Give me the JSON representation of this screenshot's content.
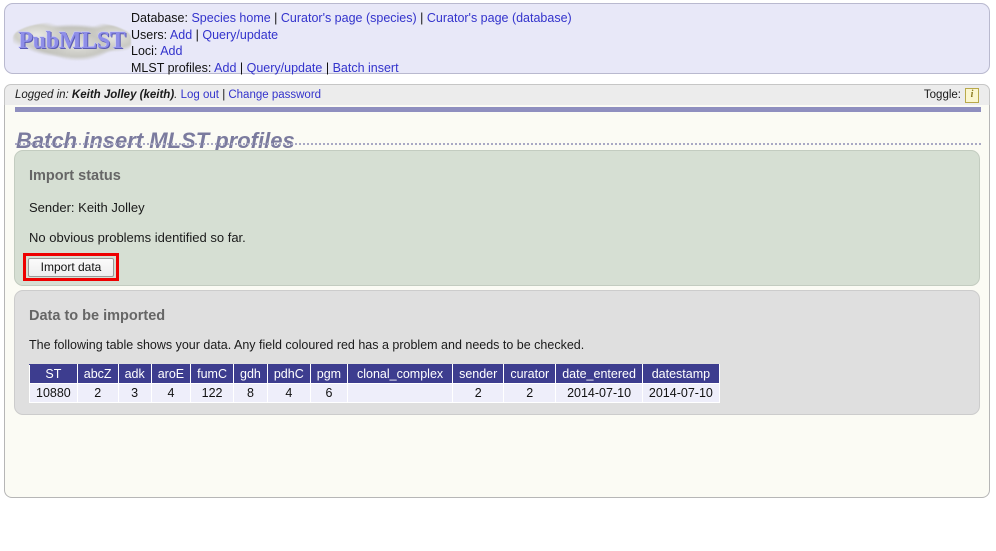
{
  "header": {
    "logo_text": "PubMLST",
    "nav_rows": [
      {
        "label": "Database:",
        "links": [
          "Species home",
          "Curator's page (species)",
          "Curator's page (database)"
        ]
      },
      {
        "label": "Users:",
        "links": [
          "Add",
          "Query/update"
        ]
      },
      {
        "label": "Loci:",
        "links": [
          "Add"
        ]
      },
      {
        "label": "MLST profiles:",
        "links": [
          "Add",
          "Query/update",
          "Batch insert"
        ]
      }
    ]
  },
  "loginbar": {
    "logged_in_prefix": "Logged in:",
    "user_name": "Keith Jolley (keith)",
    "period": ".",
    "logout_label": "Log out",
    "separator": "|",
    "change_password_label": "Change password",
    "toggle_label": "Toggle:",
    "toggle_icon_glyph": "i"
  },
  "page": {
    "title": "Batch insert MLST profiles"
  },
  "import_status": {
    "heading": "Import status",
    "sender_line": "Sender: Keith Jolley",
    "problems_line": "No obvious problems identified so far.",
    "import_button_label": "Import data"
  },
  "data_to_import": {
    "heading": "Data to be imported",
    "description": "The following table shows your data. Any field coloured red has a problem and needs to be checked.",
    "columns": [
      "ST",
      "abcZ",
      "adk",
      "aroE",
      "fumC",
      "gdh",
      "pdhC",
      "pgm",
      "clonal_complex",
      "sender",
      "curator",
      "date_entered",
      "datestamp"
    ],
    "rows": [
      [
        "10880",
        "2",
        "3",
        "4",
        "122",
        "8",
        "4",
        "6",
        "",
        "2",
        "2",
        "2014-07-10",
        "2014-07-10"
      ]
    ]
  },
  "colors": {
    "nav_background": "#e8e8f8",
    "link": "#3333cc",
    "title": "#7b7b9e",
    "title_rule": "#8f8fbf",
    "status_green": "#d6dfd3",
    "status_grey": "#dfdfdf",
    "table_header": "#3d3d8f",
    "table_cell": "#eeeefa",
    "annotation_red": "#ee0000",
    "content_background": "#fbfbf4"
  }
}
